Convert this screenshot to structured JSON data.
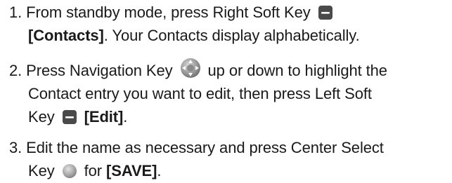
{
  "steps": [
    {
      "number": "1.",
      "line1_pre": "From standby mode, press Right Soft Key",
      "line2_bold": "[Contacts]",
      "line2_post": ". Your Contacts display alphabetically.",
      "icon": "right-soft-key-icon"
    },
    {
      "number": "2.",
      "line1_pre": "Press Navigation Key",
      "line1_post": "up or down to highlight the",
      "line2": "Contact entry you want to edit, then press Left Soft",
      "line3_pre": "Key",
      "line3_bold": "[Edit]",
      "line3_post": ".",
      "icon1": "navigation-key-icon",
      "icon2": "left-soft-key-icon"
    },
    {
      "number": "3.",
      "line1": "Edit the name as necessary and press Center Select",
      "line2_pre": "Key",
      "line2_mid": "for",
      "line2_bold": "[SAVE]",
      "line2_post": ".",
      "icon": "center-select-key-icon"
    }
  ],
  "colors": {
    "text": "#1a1a1a",
    "soft_key_fill": "#4a4a4a",
    "soft_key_bar": "#ffffff",
    "nav_key_fill": "#8a8a8a",
    "center_key_fill": "#a0a0a0"
  }
}
